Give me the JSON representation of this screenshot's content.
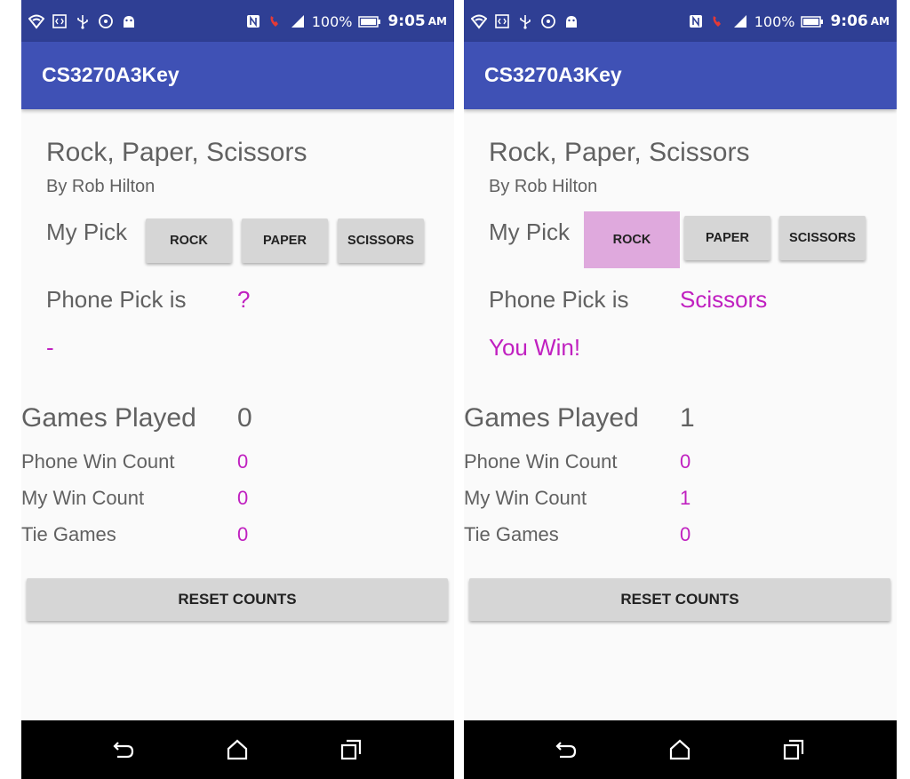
{
  "screens": [
    {
      "status": {
        "battery": "100%",
        "time": "9:05",
        "ampm": "AM"
      },
      "app_title": "CS3270A3Key",
      "game_title": "Rock, Paper, Scissors",
      "author": "By Rob Hilton",
      "my_pick_label": "My Pick",
      "buttons": {
        "rock": "ROCK",
        "paper": "PAPER",
        "scissors": "SCISSORS"
      },
      "phone_pick_label": "Phone Pick is",
      "phone_pick_value": "?",
      "result": "-",
      "games_played_label": "Games Played",
      "games_played": "0",
      "phone_win_label": "Phone Win Count",
      "phone_win": "0",
      "my_win_label": "My Win Count",
      "my_win": "0",
      "tie_label": "Tie Games",
      "ties": "0",
      "reset_label": "RESET COUNTS"
    },
    {
      "status": {
        "battery": "100%",
        "time": "9:06",
        "ampm": "AM"
      },
      "app_title": "CS3270A3Key",
      "game_title": "Rock, Paper, Scissors",
      "author": "By Rob Hilton",
      "my_pick_label": "My Pick",
      "buttons": {
        "rock": "ROCK",
        "paper": "PAPER",
        "scissors": "SCISSORS"
      },
      "phone_pick_label": "Phone Pick is",
      "phone_pick_value": "Scissors",
      "result": "You Win!",
      "games_played_label": "Games Played",
      "games_played": "1",
      "phone_win_label": "Phone Win Count",
      "phone_win": "0",
      "my_win_label": "My Win Count",
      "my_win": "1",
      "tie_label": "Tie Games",
      "ties": "0",
      "reset_label": "RESET COUNTS",
      "selected_button": "rock"
    }
  ],
  "colors": {
    "status_bar": "#2f3f94",
    "app_bar": "#3f51b5",
    "accent_text": "#c020c0",
    "selected_button": "#dfa9dd",
    "button": "#d6d6d6"
  },
  "icons": {
    "status_left": [
      "wifi-icon",
      "code-icon",
      "usb-icon",
      "sync-icon",
      "android-icon"
    ],
    "status_right": [
      "nfc-icon",
      "call-icon",
      "signal-icon",
      "battery-icon"
    ],
    "nav": [
      "back-icon",
      "home-icon",
      "recent-apps-icon"
    ]
  }
}
